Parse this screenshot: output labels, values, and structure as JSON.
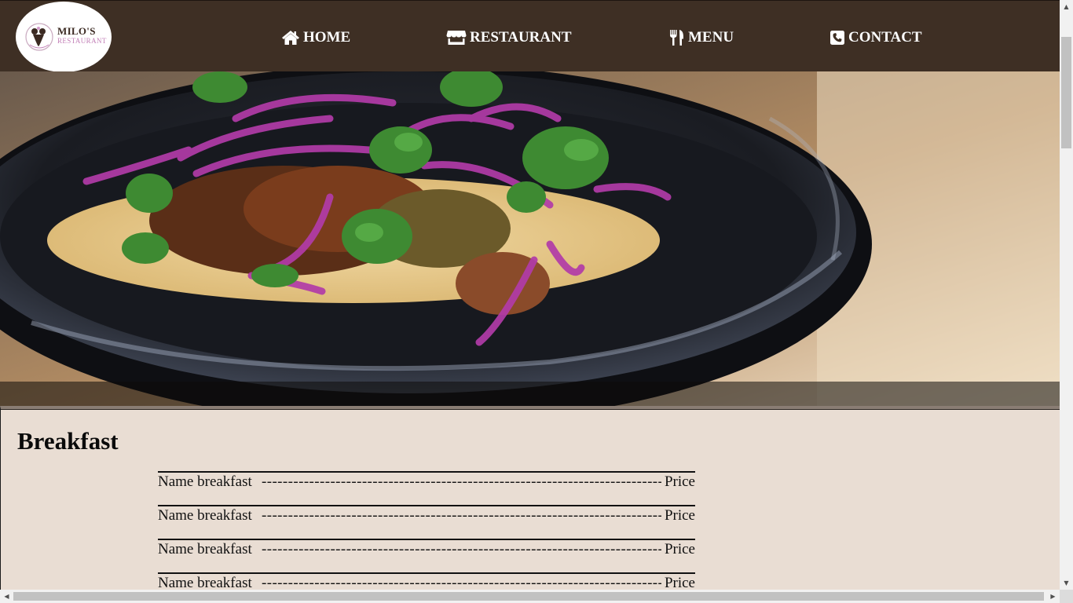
{
  "header": {
    "logo": {
      "line1": "MILO'S",
      "line2": "RESTAURANT"
    },
    "nav": [
      {
        "label": "HOME",
        "icon": "home-icon"
      },
      {
        "label": "RESTAURANT",
        "icon": "store-icon"
      },
      {
        "label": "MENU",
        "icon": "utensils-icon"
      },
      {
        "label": "CONTACT",
        "icon": "phone-square-icon"
      }
    ]
  },
  "hero": {
    "image": "taco-plate-photo"
  },
  "menu": {
    "section_title": "Breakfast",
    "items": [
      {
        "name": "Name breakfast",
        "dashes": "------------------------------------------------------------------------------",
        "price": "Price"
      },
      {
        "name": "Name breakfast",
        "dashes": "------------------------------------------------------------------------------",
        "price": "Price"
      },
      {
        "name": "Name breakfast",
        "dashes": "------------------------------------------------------------------------------",
        "price": "Price"
      },
      {
        "name": "Name breakfast",
        "dashes": "------------------------------------------------------------------------------",
        "price": "Price"
      }
    ]
  },
  "colors": {
    "header_bg": "#3e2f24",
    "section_bg": "#e9ddd3",
    "nav_text": "#ffffff",
    "logo_accent": "#c27fb7"
  }
}
